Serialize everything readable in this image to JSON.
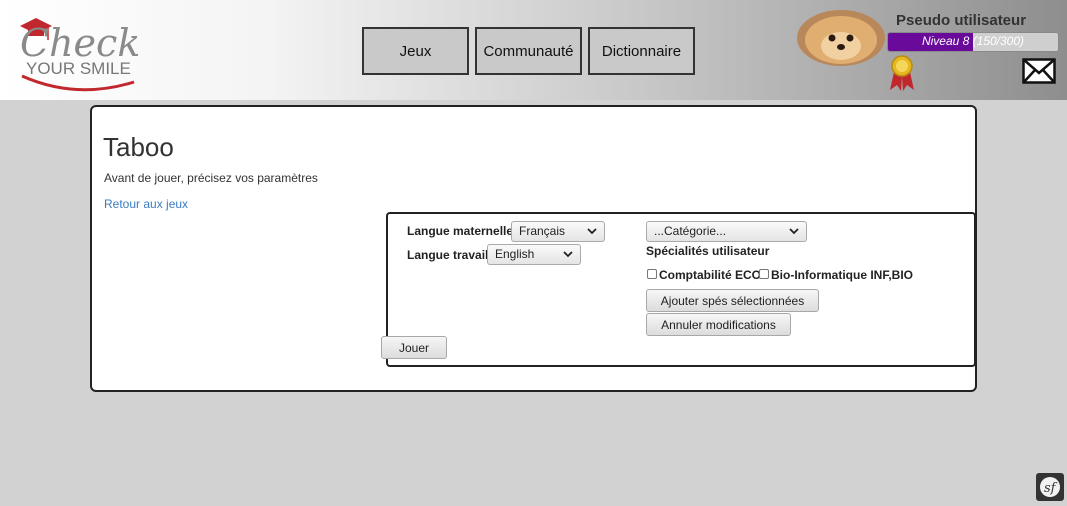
{
  "logo": {
    "line1": "Check",
    "line2": "YOUR SMILE"
  },
  "nav": {
    "games": "Jeux",
    "community": "Communauté",
    "dictionary": "Dictionnaire"
  },
  "user": {
    "name": "Pseudo utilisateur",
    "level_text": "Niveau 8 (150/300)",
    "level_progress": 0.5
  },
  "page": {
    "title": "Taboo",
    "subtitle": "Avant de jouer, précisez vos paramètres",
    "back_link": "Retour aux jeux"
  },
  "settings": {
    "native_language_label": "Langue maternelle",
    "native_language_value": "Français",
    "work_language_label": "Langue travail",
    "work_language_value": "English",
    "category_value": "...Catégorie...",
    "specialties_label": "Spécialités utilisateur",
    "specialty_1": "Comptabilité ECO",
    "specialty_2": "Bio-Informatique INF,BIO",
    "add_button": "Ajouter spés sélectionnées",
    "cancel_button": "Annuler modifications",
    "play_button": "Jouer"
  },
  "colors": {
    "level_fill": "#6a0a9a",
    "link": "#3a7cc2",
    "logo_red": "#c0282d"
  },
  "icons": {
    "mail": "envelope-icon",
    "medal": "medal-icon",
    "sf": "symfony-icon"
  }
}
